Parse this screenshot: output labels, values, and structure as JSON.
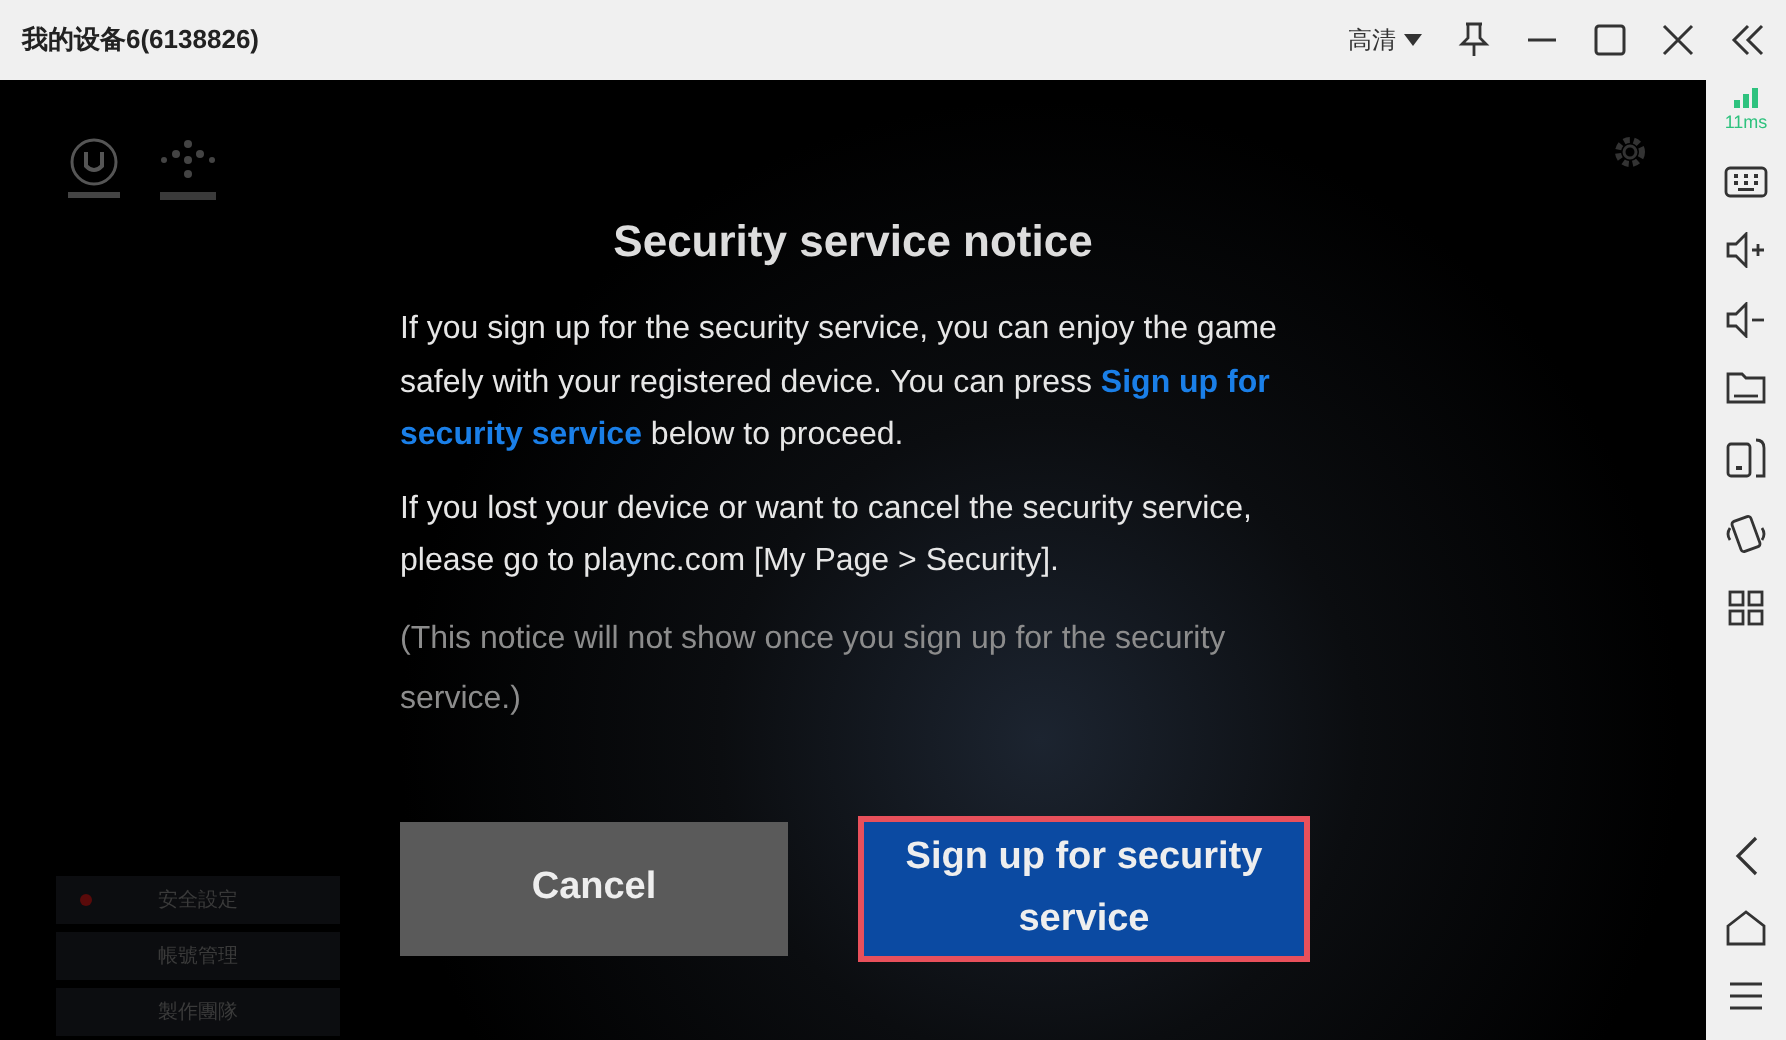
{
  "window": {
    "title": "我的设备6(6138826)",
    "quality": "高清"
  },
  "game": {
    "menu": [
      {
        "label": "安全設定",
        "alert": true
      },
      {
        "label": "帳號管理",
        "alert": false
      },
      {
        "label": "製作團隊",
        "alert": false
      }
    ]
  },
  "dialog": {
    "title": "Security service notice",
    "paragraphs": [
      "If you sign up for the security service, you can enjoy the game safely with your registered device. You can press **Sign up for security service** below to proceed.",
      "If you lost your device or want to cancel the security service, please go to plaync.com [My Page > Security]."
    ],
    "note": "(This notice will not show once you sign up for the security service.)",
    "buttons": [
      {
        "label": "Cancel",
        "kind": "secondary",
        "highlighted": false
      },
      {
        "label": "Sign up for security service",
        "kind": "primary",
        "highlighted": true
      }
    ]
  },
  "sidebar": {
    "latency": "11ms"
  }
}
